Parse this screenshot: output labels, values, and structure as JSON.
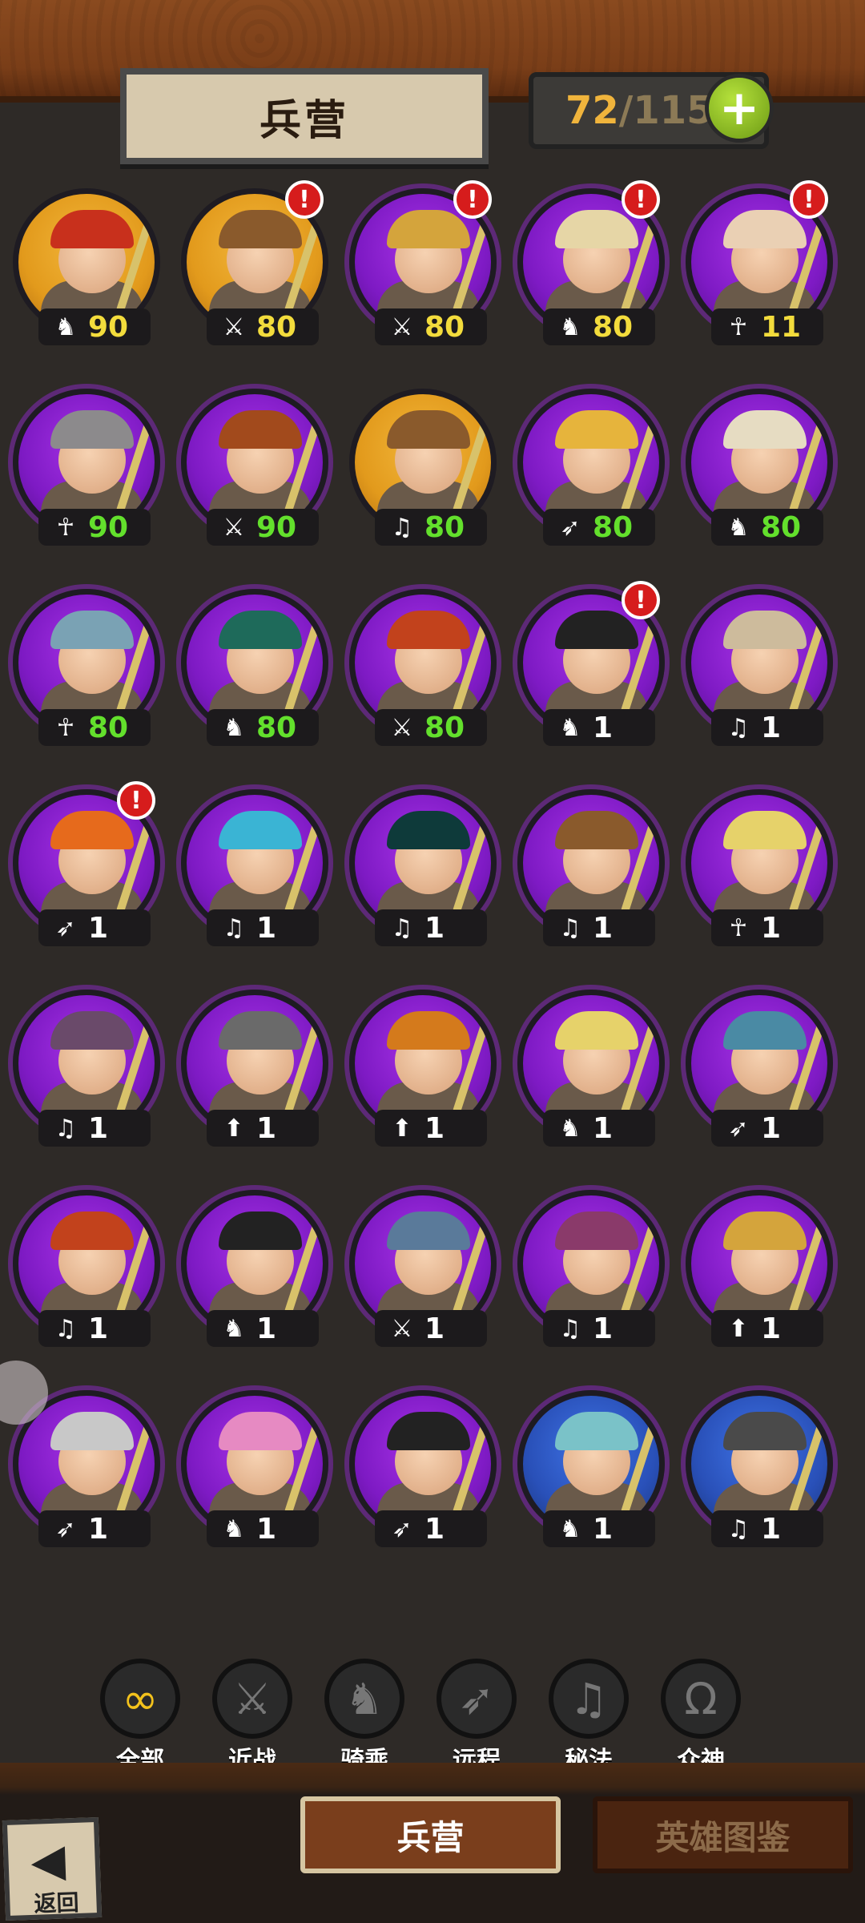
{
  "header": {
    "title": "兵营",
    "count_current": "72",
    "count_sep": "/",
    "count_max": "115",
    "add_label": "+"
  },
  "heroes": [
    {
      "frame": "gold",
      "class": "mounted",
      "level": "90",
      "level_color": "y",
      "alert": false,
      "helm": "#c8301c"
    },
    {
      "frame": "gold",
      "class": "melee",
      "level": "80",
      "level_color": "y",
      "alert": true,
      "helm": "#8a5a2c"
    },
    {
      "frame": "purple",
      "class": "melee",
      "level": "80",
      "level_color": "y",
      "alert": true,
      "helm": "#d4a43c"
    },
    {
      "frame": "purple",
      "class": "mounted",
      "level": "80",
      "level_color": "y",
      "alert": true,
      "helm": "#e6d6a6"
    },
    {
      "frame": "purple",
      "class": "gods",
      "level": "11",
      "level_color": "y",
      "alert": true,
      "helm": "#ead0b4"
    },
    {
      "frame": "purple",
      "class": "gods",
      "level": "90",
      "level_color": "g",
      "alert": false,
      "helm": "#8c8a8c"
    },
    {
      "frame": "purple",
      "class": "melee",
      "level": "90",
      "level_color": "g",
      "alert": false,
      "helm": "#a24a1c"
    },
    {
      "frame": "gold",
      "class": "arcane",
      "level": "80",
      "level_color": "g",
      "alert": false,
      "helm": "#8a5a2c"
    },
    {
      "frame": "purple",
      "class": "ranged",
      "level": "80",
      "level_color": "g",
      "alert": false,
      "helm": "#e6b43c"
    },
    {
      "frame": "purple",
      "class": "mounted",
      "level": "80",
      "level_color": "g",
      "alert": false,
      "helm": "#e6dcc2"
    },
    {
      "frame": "purple",
      "class": "gods",
      "level": "80",
      "level_color": "g",
      "alert": false,
      "helm": "#7aa2b4"
    },
    {
      "frame": "purple",
      "class": "mounted",
      "level": "80",
      "level_color": "g",
      "alert": false,
      "helm": "#1e6a5a"
    },
    {
      "frame": "purple",
      "class": "melee",
      "level": "80",
      "level_color": "g",
      "alert": false,
      "helm": "#c2421c"
    },
    {
      "frame": "purple",
      "class": "mounted",
      "level": "1",
      "level_color": "w",
      "alert": true,
      "helm": "#222222"
    },
    {
      "frame": "purple",
      "class": "arcane",
      "level": "1",
      "level_color": "w",
      "alert": false,
      "helm": "#cdbb9c"
    },
    {
      "frame": "purple",
      "class": "ranged",
      "level": "1",
      "level_color": "w",
      "alert": true,
      "helm": "#e66a1c"
    },
    {
      "frame": "purple",
      "class": "arcane",
      "level": "1",
      "level_color": "w",
      "alert": false,
      "helm": "#3ab4d4"
    },
    {
      "frame": "purple",
      "class": "arcane",
      "level": "1",
      "level_color": "w",
      "alert": false,
      "helm": "#0e3a3a"
    },
    {
      "frame": "purple",
      "class": "arcane",
      "level": "1",
      "level_color": "w",
      "alert": false,
      "helm": "#8a5a2c"
    },
    {
      "frame": "purple",
      "class": "gods",
      "level": "1",
      "level_color": "w",
      "alert": false,
      "helm": "#e6d26a"
    },
    {
      "frame": "purple",
      "class": "arcane",
      "level": "1",
      "level_color": "w",
      "alert": false,
      "helm": "#6a4a6a"
    },
    {
      "frame": "purple",
      "class": "spear",
      "level": "1",
      "level_color": "w",
      "alert": false,
      "helm": "#6a6a6a"
    },
    {
      "frame": "purple",
      "class": "spear",
      "level": "1",
      "level_color": "w",
      "alert": false,
      "helm": "#d47a1c"
    },
    {
      "frame": "purple",
      "class": "mounted",
      "level": "1",
      "level_color": "w",
      "alert": false,
      "helm": "#e6d26a"
    },
    {
      "frame": "purple",
      "class": "ranged",
      "level": "1",
      "level_color": "w",
      "alert": false,
      "helm": "#4a8aa4"
    },
    {
      "frame": "purple",
      "class": "arcane",
      "level": "1",
      "level_color": "w",
      "alert": false,
      "helm": "#c2421c"
    },
    {
      "frame": "purple",
      "class": "mounted",
      "level": "1",
      "level_color": "w",
      "alert": false,
      "helm": "#222222"
    },
    {
      "frame": "purple",
      "class": "melee",
      "level": "1",
      "level_color": "w",
      "alert": false,
      "helm": "#5a7a9a"
    },
    {
      "frame": "purple",
      "class": "arcane",
      "level": "1",
      "level_color": "w",
      "alert": false,
      "helm": "#8a3a6a"
    },
    {
      "frame": "purple",
      "class": "spear",
      "level": "1",
      "level_color": "w",
      "alert": false,
      "helm": "#d4a43c"
    },
    {
      "frame": "purple",
      "class": "ranged",
      "level": "1",
      "level_color": "w",
      "alert": false,
      "helm": "#c8c8c8"
    },
    {
      "frame": "purple",
      "class": "mounted",
      "level": "1",
      "level_color": "w",
      "alert": false,
      "helm": "#e68ac2"
    },
    {
      "frame": "purple",
      "class": "ranged",
      "level": "1",
      "level_color": "w",
      "alert": false,
      "helm": "#222222"
    },
    {
      "frame": "blue",
      "class": "mounted",
      "level": "1",
      "level_color": "w",
      "alert": false,
      "helm": "#7ac2c8"
    },
    {
      "frame": "blue",
      "class": "arcane",
      "level": "1",
      "level_color": "w",
      "alert": false,
      "helm": "#4a4a4a"
    }
  ],
  "class_icons": {
    "mounted": "♞",
    "melee": "⚔",
    "gods": "☥",
    "arcane": "♫",
    "ranged": "➶",
    "spear": "⬆"
  },
  "alert_mark": "!",
  "filters": [
    {
      "key": "all",
      "label": "全部",
      "icon": "∞",
      "active": true
    },
    {
      "key": "melee",
      "label": "近战",
      "icon": "⚔",
      "active": false
    },
    {
      "key": "mounted",
      "label": "骑乘",
      "icon": "♞",
      "active": false
    },
    {
      "key": "ranged",
      "label": "远程",
      "icon": "➶",
      "active": false
    },
    {
      "key": "arcane",
      "label": "秘法",
      "icon": "♫",
      "active": false
    },
    {
      "key": "gods",
      "label": "众神",
      "icon": "Ω",
      "active": false
    }
  ],
  "bottom": {
    "tab_active": "兵营",
    "tab_inactive": "英雄图鉴",
    "back_arrow": "◀",
    "back_label": "返回"
  },
  "colors": {
    "frame_gold": "#e29a1c",
    "frame_purple": "#7e1ac4",
    "frame_blue": "#2950b8",
    "level_yellow": "#f3dc3c",
    "level_green": "#63e02c",
    "alert_red": "#d61c1c",
    "count_current": "#f0b43c",
    "add_button": "#8cc21c"
  }
}
